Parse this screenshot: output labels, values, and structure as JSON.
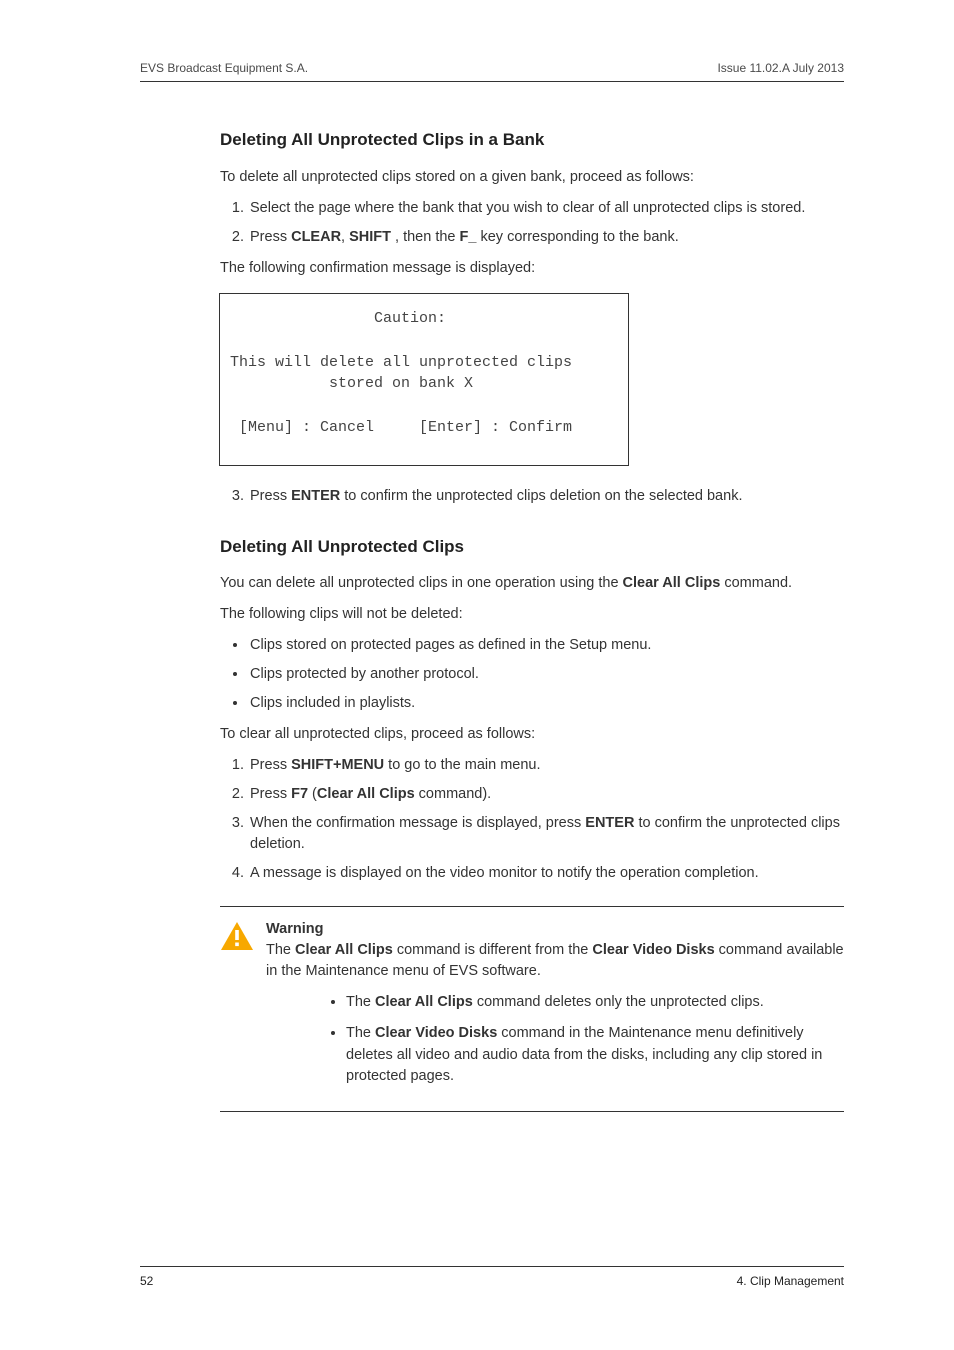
{
  "header": {
    "left": "EVS Broadcast Equipment S.A.",
    "right": "Issue 11.02.A  July 2013"
  },
  "section1": {
    "title": "Deleting All Unprotected Clips in a Bank",
    "intro": "To delete all unprotected clips stored on a given bank, proceed as follows:",
    "step1": "Select the page where the bank that you wish to clear of all unprotected clips is stored.",
    "step2a": "Press ",
    "step2b": "CLEAR",
    "step2c": ", ",
    "step2d": "SHIFT",
    "step2e": " , then the ",
    "step2f": "F_",
    "step2g": " key corresponding to the bank.",
    "confirm_intro": "The following confirmation message is displayed:",
    "caution_text": "                Caution:\n\nThis will delete all unprotected clips\n           stored on bank X\n\n [Menu] : Cancel     [Enter] : Confirm",
    "step3a": "Press ",
    "step3b": "ENTER",
    "step3c": " to confirm the unprotected clips deletion on the selected bank."
  },
  "section2": {
    "title": "Deleting All Unprotected Clips",
    "intro_a": "You can delete all unprotected clips in one operation using the ",
    "intro_b": "Clear All Clips",
    "intro_c": " command.",
    "not_deleted_intro": "The following clips will not be deleted:",
    "bul1": "Clips stored on protected pages as defined in the Setup menu.",
    "bul2": "Clips protected by another protocol.",
    "bul3": "Clips included in playlists.",
    "proceed_intro": "To clear all unprotected clips, proceed as follows:",
    "s1a": "Press ",
    "s1b": "SHIFT+MENU",
    "s1c": " to go to the main menu.",
    "s2a": "Press ",
    "s2b": "F7",
    "s2c": " (",
    "s2d": "Clear All Clips",
    "s2e": " command).",
    "s3a": "When the confirmation message is displayed, press ",
    "s3b": "ENTER",
    "s3c": " to confirm the unprotected clips deletion.",
    "s4": "A message is displayed on the video monitor to notify the operation completion."
  },
  "warning": {
    "title": "Warning",
    "p1a": "The ",
    "p1b": "Clear All Clips",
    "p1c": " command is different from the ",
    "p1d": "Clear Video Disks",
    "p1e": " command available in the Maintenance menu of EVS software.",
    "b1a": "The ",
    "b1b": "Clear All Clips",
    "b1c": " command deletes only the unprotected clips.",
    "b2a": "The ",
    "b2b": "Clear Video Disks",
    "b2c": " command in the Maintenance menu definitively deletes all video and audio data from the disks, including any clip stored in protected pages."
  },
  "footer": {
    "page": "52",
    "chapter": "4. Clip Management"
  }
}
